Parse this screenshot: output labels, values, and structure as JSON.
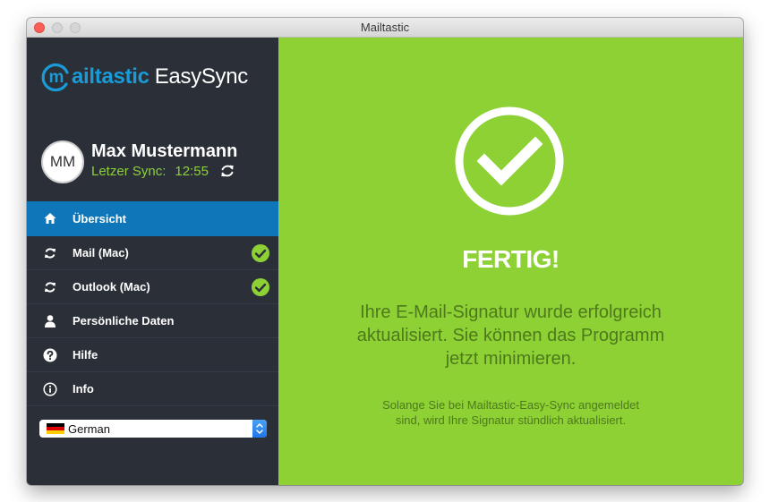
{
  "window": {
    "title": "Mailtastic"
  },
  "brand": {
    "name": "mailtastic",
    "name_rest": "ailtastic",
    "product": "EasySync",
    "color": "#1a9ad6"
  },
  "user": {
    "initials": "MM",
    "name": "Max Mustermann",
    "sync_label": "Letzer Sync:",
    "sync_time": "12:55"
  },
  "nav": {
    "items": [
      {
        "label": "Übersicht",
        "icon": "home-icon",
        "active": true,
        "synced": false
      },
      {
        "label": "Mail (Mac)",
        "icon": "sync-icon",
        "active": false,
        "synced": true
      },
      {
        "label": "Outlook (Mac)",
        "icon": "sync-icon",
        "active": false,
        "synced": true
      },
      {
        "label": "Persönliche Daten",
        "icon": "user-icon",
        "active": false,
        "synced": false
      },
      {
        "label": "Hilfe",
        "icon": "help-icon",
        "active": false,
        "synced": false
      },
      {
        "label": "Info",
        "icon": "info-icon",
        "active": false,
        "synced": false
      }
    ]
  },
  "language": {
    "selected": "German",
    "flag": "flag-germany-icon"
  },
  "main": {
    "status_icon": "checkmark-circle-icon",
    "title": "FERTIG!",
    "message": "Ihre E-Mail-Signatur wurde erfolgreich aktualisiert. Sie können das Programm jetzt minimieren.",
    "note": "Solange Sie bei Mailtastic-Easy-Sync angemeldet sind, wird Ihre Signatur stündlich aktualisiert."
  },
  "colors": {
    "sidebar": "#2b3038",
    "active": "#0f77b9",
    "accent_green": "#8dd135",
    "success_text": "#4e7a1c"
  }
}
